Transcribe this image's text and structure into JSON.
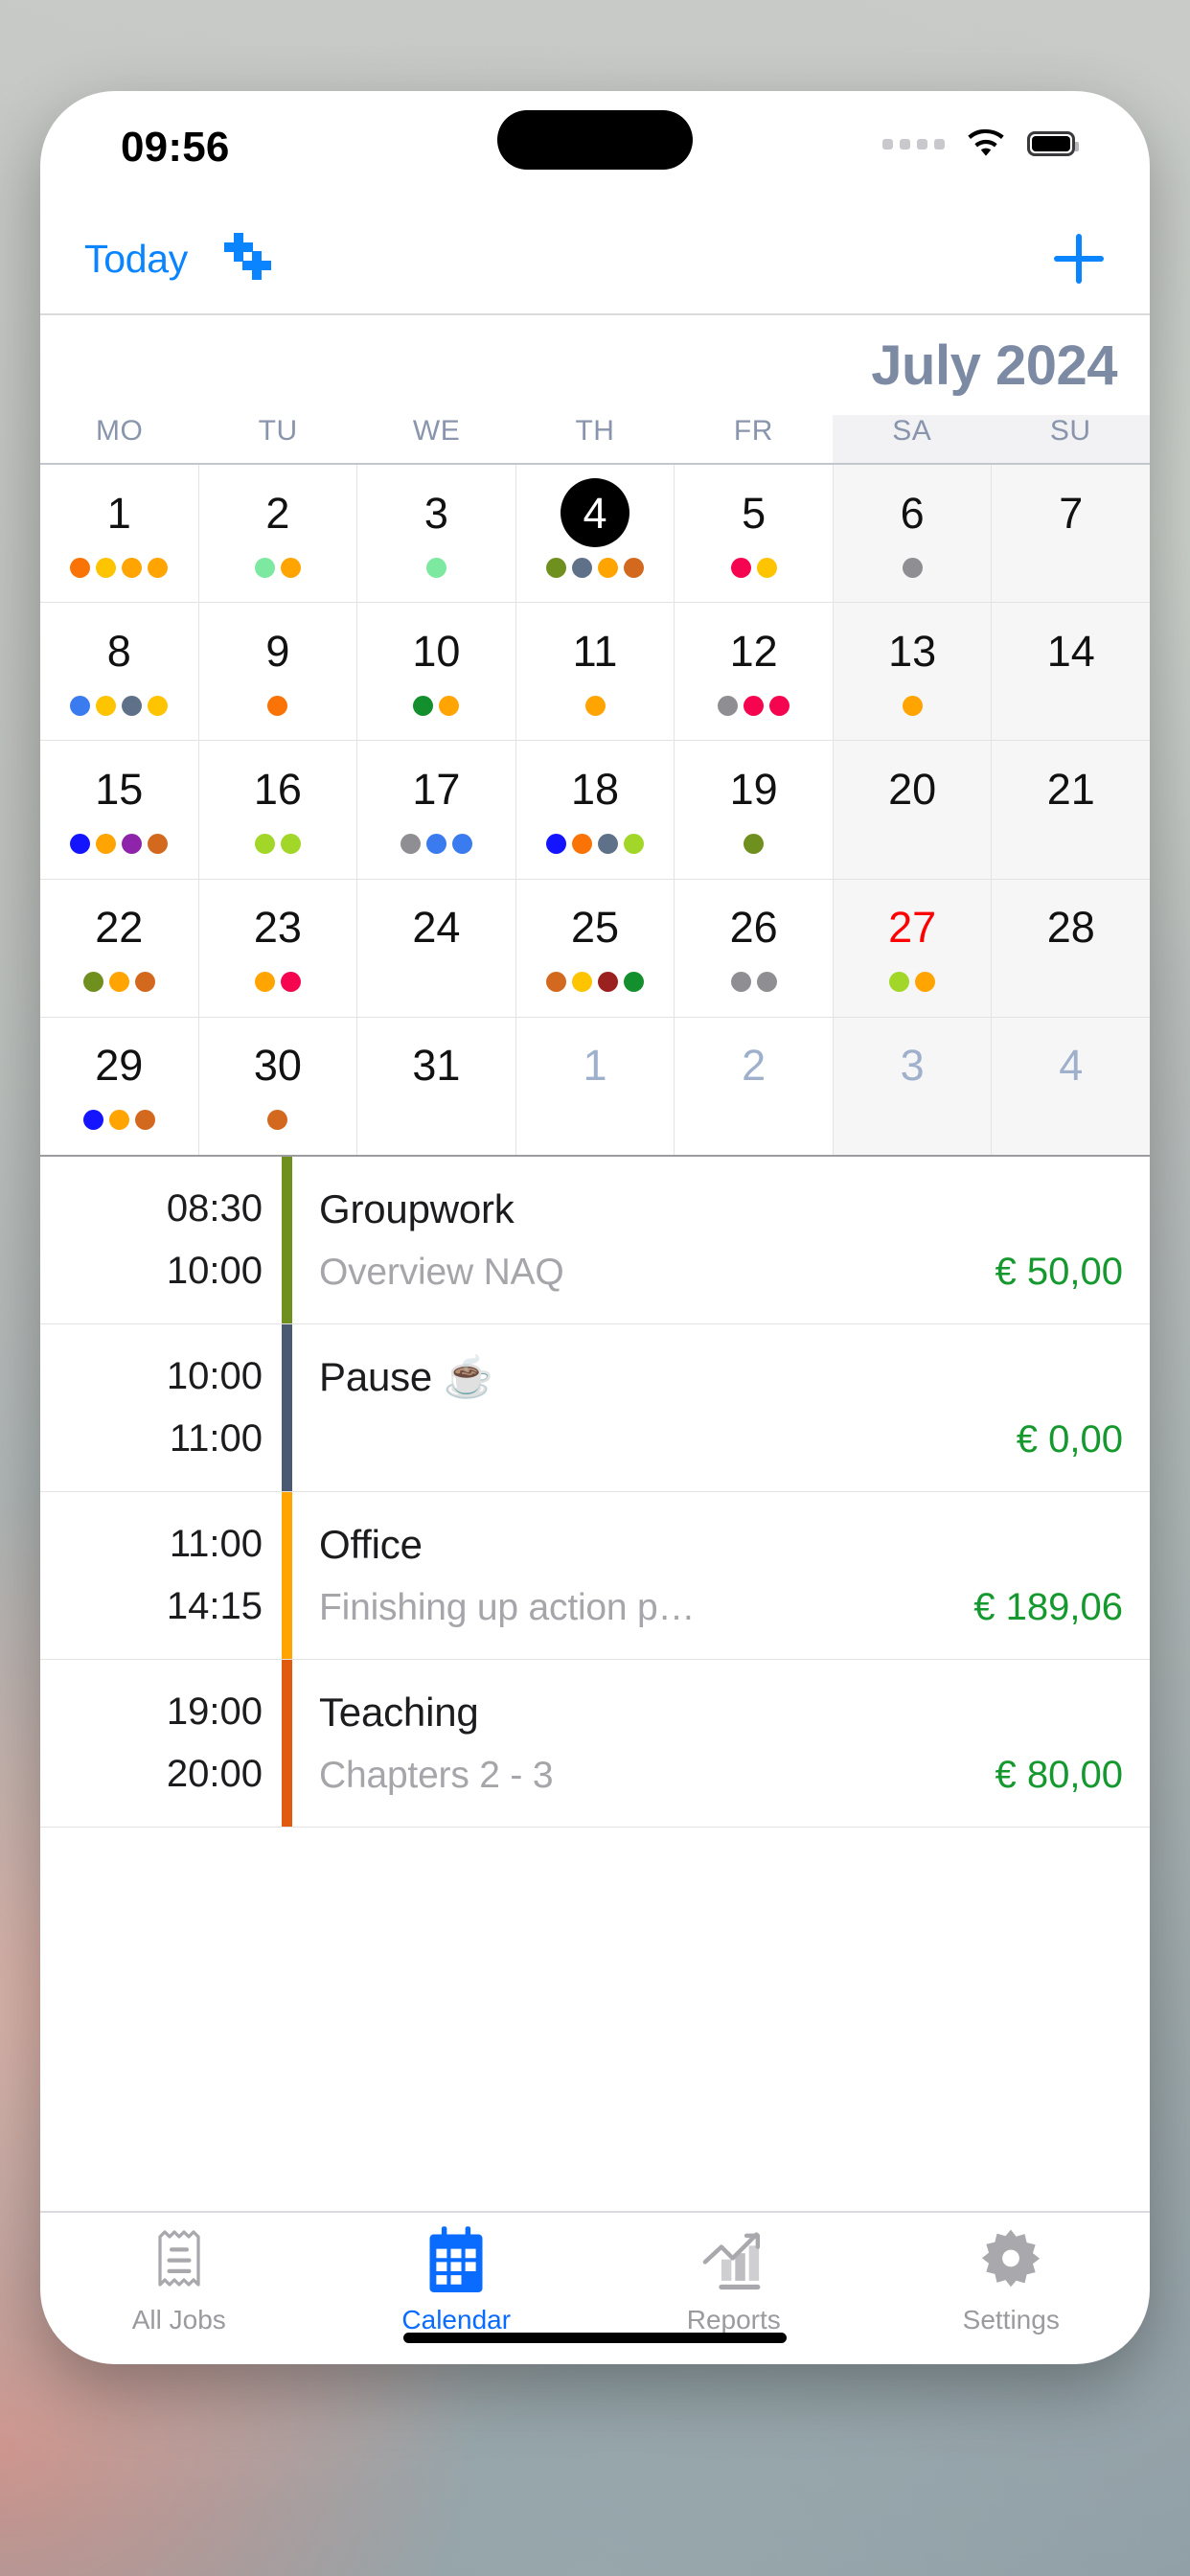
{
  "status_bar": {
    "time": "09:56",
    "signal_icon": "signal-dots-icon",
    "wifi_icon": "wifi-icon",
    "battery_icon": "battery-full-icon"
  },
  "navbar": {
    "today_label": "Today",
    "duplicate_icon": "duplicate-plus-icon",
    "add_icon": "plus-icon"
  },
  "calendar": {
    "month_title": "July 2024",
    "weekdays": [
      "MO",
      "TU",
      "WE",
      "TH",
      "FR",
      "SA",
      "SU"
    ],
    "weeks": [
      [
        {
          "day": "1",
          "state": "normal",
          "dots": [
            "#f97306",
            "#ffc400",
            "#ffa400",
            "#ffa400"
          ]
        },
        {
          "day": "2",
          "state": "normal",
          "dots": [
            "#7ce8a0",
            "#ffa400"
          ]
        },
        {
          "day": "3",
          "state": "normal",
          "dots": [
            "#7ce8a0"
          ]
        },
        {
          "day": "4",
          "state": "today",
          "dots": [
            "#6f8f1f",
            "#5f7188",
            "#ffa400",
            "#d2691e"
          ]
        },
        {
          "day": "5",
          "state": "normal",
          "dots": [
            "#f5054f",
            "#ffc400"
          ]
        },
        {
          "day": "6",
          "state": "weekend",
          "dots": [
            "#8e8e93"
          ]
        },
        {
          "day": "7",
          "state": "weekend",
          "dots": []
        }
      ],
      [
        {
          "day": "8",
          "state": "normal",
          "dots": [
            "#3b7bf0",
            "#ffc400",
            "#5f7188",
            "#ffc400"
          ]
        },
        {
          "day": "9",
          "state": "normal",
          "dots": [
            "#f97306"
          ]
        },
        {
          "day": "10",
          "state": "normal",
          "dots": [
            "#138f2d",
            "#ffa400"
          ]
        },
        {
          "day": "11",
          "state": "normal",
          "dots": [
            "#ffa400"
          ]
        },
        {
          "day": "12",
          "state": "normal",
          "dots": [
            "#8e8e93",
            "#f5054f",
            "#f5054f"
          ]
        },
        {
          "day": "13",
          "state": "weekend",
          "dots": [
            "#ffa400"
          ]
        },
        {
          "day": "14",
          "state": "weekend",
          "dots": []
        }
      ],
      [
        {
          "day": "15",
          "state": "normal",
          "dots": [
            "#1414ff",
            "#ffa400",
            "#8e24aa",
            "#d2691e"
          ]
        },
        {
          "day": "16",
          "state": "normal",
          "dots": [
            "#a2d628",
            "#a2d628"
          ]
        },
        {
          "day": "17",
          "state": "normal",
          "dots": [
            "#8e8e93",
            "#3b7bf0",
            "#3b7bf0"
          ]
        },
        {
          "day": "18",
          "state": "normal",
          "dots": [
            "#1414ff",
            "#f97306",
            "#5f7188",
            "#a2d628"
          ]
        },
        {
          "day": "19",
          "state": "normal",
          "dots": [
            "#6f8f1f"
          ]
        },
        {
          "day": "20",
          "state": "weekend",
          "dots": []
        },
        {
          "day": "21",
          "state": "weekend",
          "dots": []
        }
      ],
      [
        {
          "day": "22",
          "state": "normal",
          "dots": [
            "#6f8f1f",
            "#ffa400",
            "#d2691e"
          ]
        },
        {
          "day": "23",
          "state": "normal",
          "dots": [
            "#ffa400",
            "#f5054f"
          ]
        },
        {
          "day": "24",
          "state": "normal",
          "dots": []
        },
        {
          "day": "25",
          "state": "normal",
          "dots": [
            "#d2691e",
            "#ffc400",
            "#9b2020",
            "#138f2d"
          ]
        },
        {
          "day": "26",
          "state": "normal",
          "dots": [
            "#8e8e93",
            "#8e8e93"
          ]
        },
        {
          "day": "27",
          "state": "holiday",
          "dots": [
            "#a2d628",
            "#ffa400"
          ]
        },
        {
          "day": "28",
          "state": "weekend",
          "dots": []
        }
      ],
      [
        {
          "day": "29",
          "state": "normal",
          "dots": [
            "#1414ff",
            "#ffa400",
            "#d2691e"
          ]
        },
        {
          "day": "30",
          "state": "normal",
          "dots": [
            "#d2691e"
          ]
        },
        {
          "day": "31",
          "state": "normal",
          "dots": []
        },
        {
          "day": "1",
          "state": "other",
          "dots": []
        },
        {
          "day": "2",
          "state": "other",
          "dots": []
        },
        {
          "day": "3",
          "state": "other-weekend",
          "dots": []
        },
        {
          "day": "4",
          "state": "other-weekend",
          "dots": []
        }
      ]
    ]
  },
  "events": [
    {
      "start": "08:30",
      "end": "10:00",
      "title": "Groupwork",
      "subtitle": "Overview NAQ",
      "amount": "€ 50,00",
      "bar_color": "#6f8f1f"
    },
    {
      "start": "10:00",
      "end": "11:00",
      "title": "Pause ☕",
      "subtitle": "",
      "amount": "€ 0,00",
      "bar_color": "#4a5a72"
    },
    {
      "start": "11:00",
      "end": "14:15",
      "title": "Office",
      "subtitle": "Finishing up action p…",
      "amount": "€ 189,06",
      "bar_color": "#ffa400"
    },
    {
      "start": "19:00",
      "end": "20:00",
      "title": "Teaching",
      "subtitle": "Chapters 2 - 3",
      "amount": "€ 80,00",
      "bar_color": "#e05a10"
    }
  ],
  "tabbar": {
    "tabs": [
      {
        "label": "All Jobs",
        "icon": "receipt-icon",
        "active": false
      },
      {
        "label": "Calendar",
        "icon": "calendar-icon",
        "active": true
      },
      {
        "label": "Reports",
        "icon": "chart-icon",
        "active": false
      },
      {
        "label": "Settings",
        "icon": "gear-icon",
        "active": false
      }
    ]
  },
  "colors": {
    "accent": "#0a84ff",
    "amount_green": "#15992f",
    "month_title": "#7d8aa4",
    "holiday_red": "#ff0000"
  }
}
